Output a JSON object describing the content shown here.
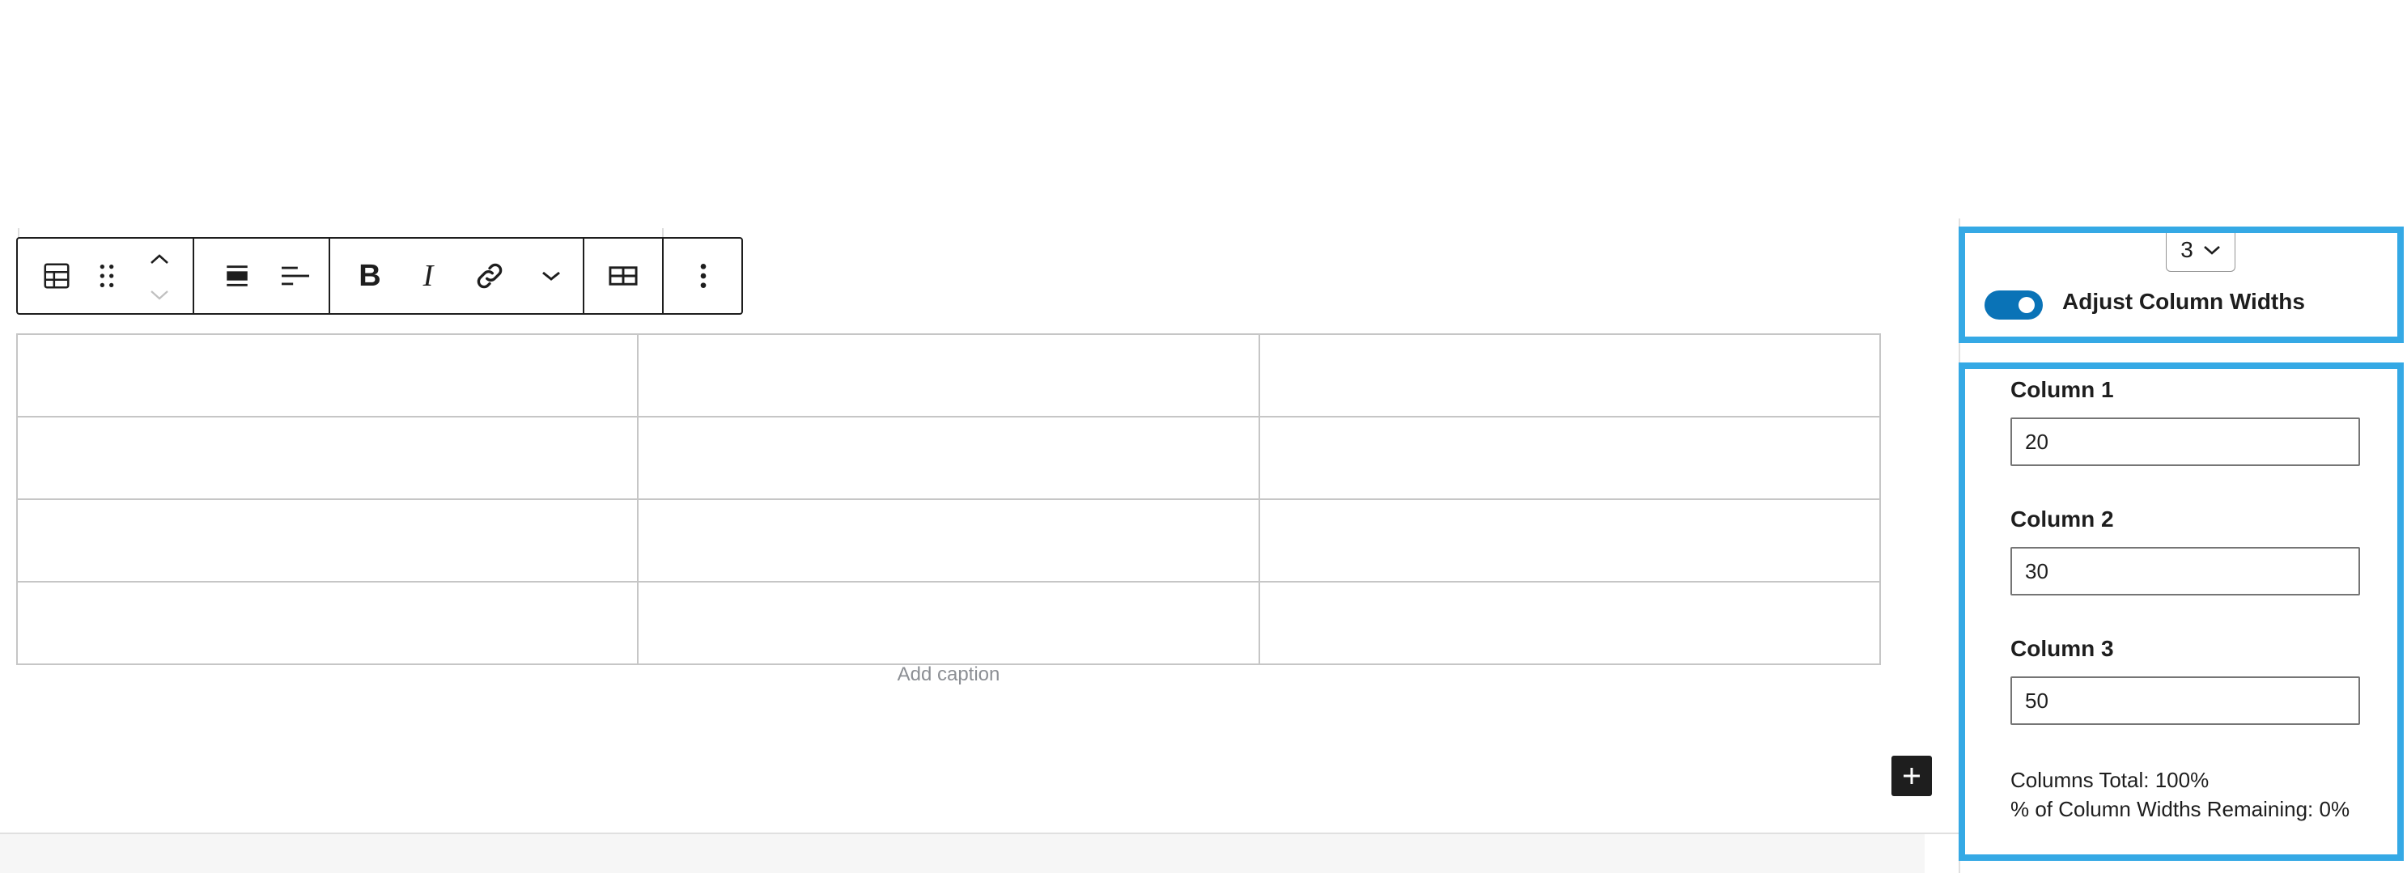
{
  "table": {
    "rows": [
      [
        "",
        "",
        ""
      ],
      [
        "",
        "",
        ""
      ],
      [
        "",
        "",
        ""
      ],
      [
        "",
        "",
        ""
      ]
    ],
    "caption_placeholder": "Add caption"
  },
  "toolbar": {
    "buttons": [
      "table-block-icon",
      "drag-handle-icon",
      "move-up-icon",
      "move-down-icon",
      "align-icon",
      "text-align-left-icon",
      "bold-icon",
      "italic-icon",
      "link-icon",
      "more-formatting-chevron-icon",
      "edit-table-icon",
      "more-options-icon"
    ],
    "bold_label": "B",
    "italic_label": "I"
  },
  "sidebar": {
    "columns_select_value": "3",
    "adjust_toggle_label": "Adjust Column Widths",
    "adjust_toggle_on": true,
    "columns": [
      {
        "label": "Column 1",
        "value": "20"
      },
      {
        "label": "Column 2",
        "value": "30"
      },
      {
        "label": "Column 3",
        "value": "50"
      }
    ],
    "columns_total": "Columns Total: 100%",
    "remaining": "% of Column Widths Remaining: 0%"
  },
  "colors": {
    "highlight": "#35a9e5",
    "toggle_on": "#0a73b7",
    "border_dark": "#1e1e1e",
    "table_border": "#c6c6c6"
  }
}
